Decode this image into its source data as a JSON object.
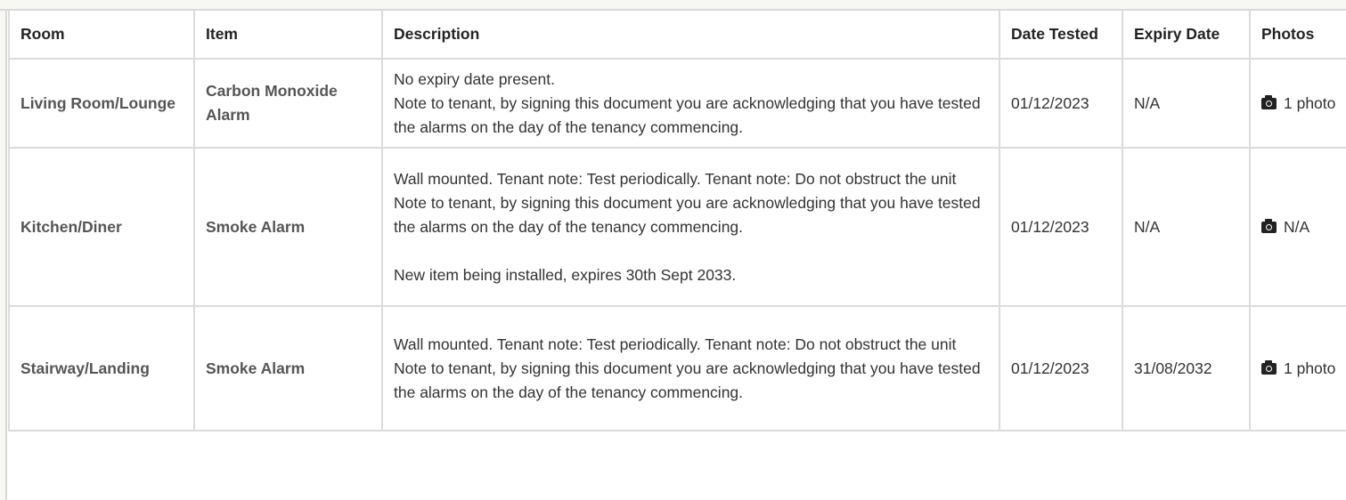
{
  "table": {
    "headers": {
      "room": "Room",
      "item": "Item",
      "description": "Description",
      "date_tested": "Date Tested",
      "expiry_date": "Expiry Date",
      "photos": "Photos"
    },
    "rows": [
      {
        "room": "Living Room/Lounge",
        "item": "Carbon Monoxide Alarm",
        "description": [
          "No expiry date present.",
          "Note to tenant, by signing this document you are acknowledging that you have tested the alarms on the day of the tenancy commencing."
        ],
        "date_tested": "01/12/2023",
        "expiry_date": "N/A",
        "photos": "1 photo"
      },
      {
        "room": "Kitchen/Diner",
        "item": "Smoke Alarm",
        "description": [
          "Wall mounted. Tenant note: Test periodically. Tenant note: Do not obstruct the unit",
          "Note to tenant, by signing this document you are acknowledging that you have tested the alarms on the day of the tenancy commencing.",
          "",
          "New item being installed, expires 30th Sept 2033."
        ],
        "date_tested": "01/12/2023",
        "expiry_date": "N/A",
        "photos": "N/A"
      },
      {
        "room": "Stairway/Landing",
        "item": "Smoke Alarm",
        "description": [
          "Wall mounted. Tenant note: Test periodically. Tenant note: Do not obstruct the unit",
          "Note to tenant, by signing this document you are acknowledging that you have tested the alarms on the day of the tenancy commencing."
        ],
        "date_tested": "01/12/2023",
        "expiry_date": "31/08/2032",
        "photos": "1 photo"
      }
    ]
  },
  "icons": {
    "photo": "camera-icon"
  }
}
